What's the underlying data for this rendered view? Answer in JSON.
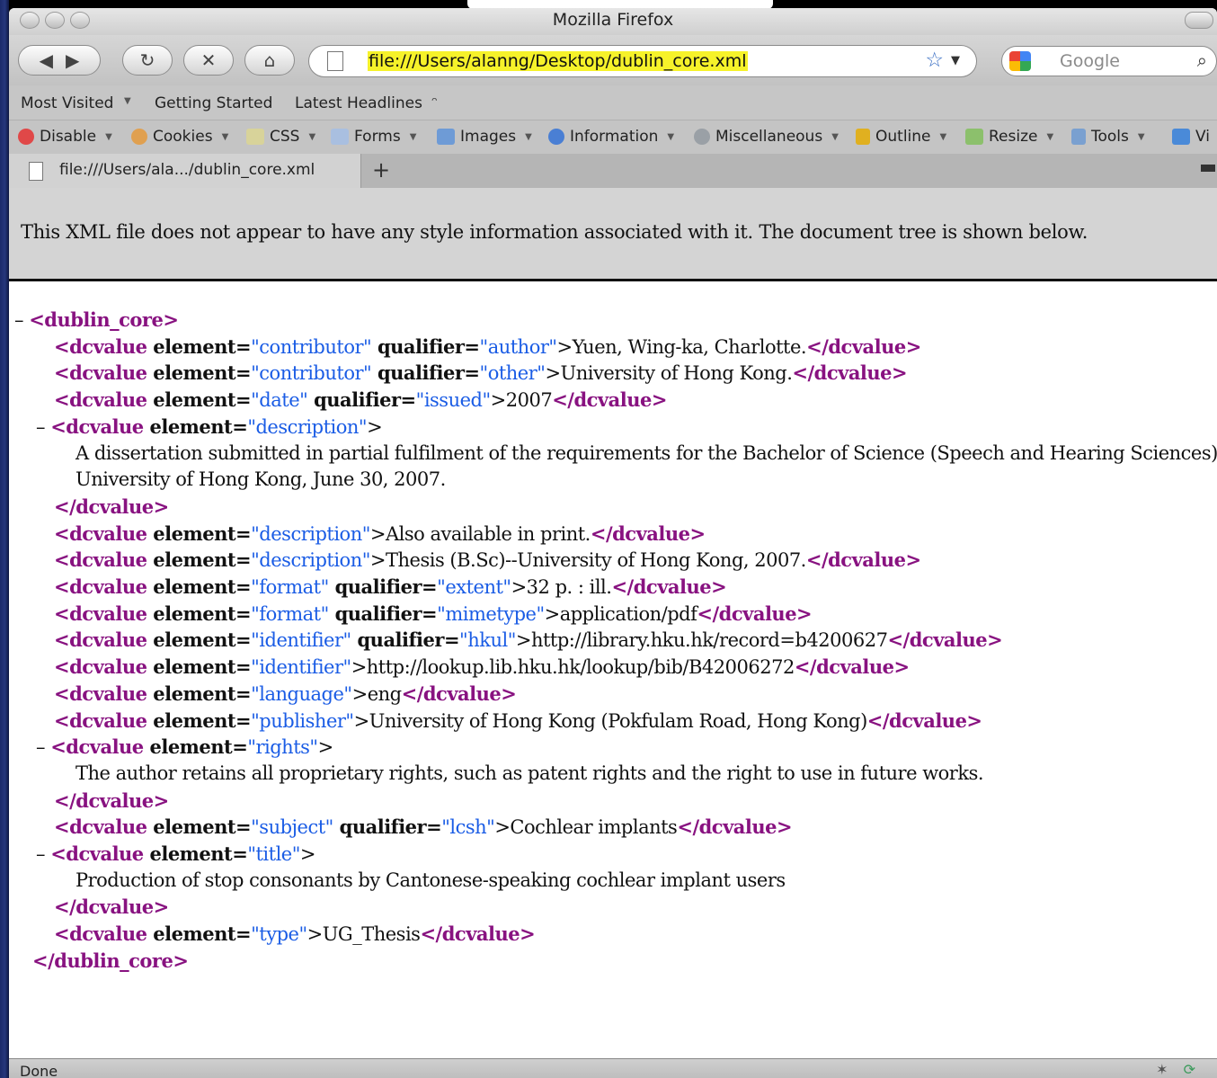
{
  "window": {
    "title": "Mozilla Firefox"
  },
  "nav": {
    "url": "file:///Users/alanng/Desktop/dublin_core.xml",
    "search_placeholder": "Google"
  },
  "bookmarks": [
    "Most Visited",
    "Getting Started",
    "Latest Headlines"
  ],
  "webdev_toolbar": [
    "Disable",
    "Cookies",
    "CSS",
    "Forms",
    "Images",
    "Information",
    "Miscellaneous",
    "Outline",
    "Resize",
    "Tools",
    "Vi"
  ],
  "tab": {
    "label": "file:///Users/ala.../dublin_core.xml",
    "new_tab": "+"
  },
  "notice": "This XML file does not appear to have any style information associated with it. The document tree is shown below.",
  "xml": {
    "root_open": "<dublin_core>",
    "root_close": "</dublin_core>",
    "collapse": "–",
    "tag_open": "<dcvalue",
    "tag_close": "</dcvalue>",
    "attr_element": "element=",
    "attr_qualifier": "qualifier=",
    "lines": [
      {
        "element": "\"contributor\"",
        "qualifier": "\"author\"",
        "text": ">Yuen, Wing-ka, Charlotte."
      },
      {
        "element": "\"contributor\"",
        "qualifier": "\"other\"",
        "text": ">University of Hong Kong."
      },
      {
        "element": "\"date\"",
        "qualifier": "\"issued\"",
        "text": ">2007"
      },
      {
        "element": "\"description\"",
        "text": ">",
        "body": [
          "A dissertation submitted in partial fulfilment of the requirements for the Bachelor of Science (Speech and Hearing Sciences), The",
          "University of Hong Kong, June 30, 2007."
        ]
      },
      {
        "element": "\"description\"",
        "text": ">Also available in print."
      },
      {
        "element": "\"description\"",
        "text": ">Thesis (B.Sc)--University of Hong Kong, 2007."
      },
      {
        "element": "\"format\"",
        "qualifier": "\"extent\"",
        "text": ">32 p. : ill."
      },
      {
        "element": "\"format\"",
        "qualifier": "\"mimetype\"",
        "text": ">application/pdf"
      },
      {
        "element": "\"identifier\"",
        "qualifier": "\"hkul\"",
        "text": ">http://library.hku.hk/record=b4200627"
      },
      {
        "element": "\"identifier\"",
        "text": ">http://lookup.lib.hku.hk/lookup/bib/B42006272"
      },
      {
        "element": "\"language\"",
        "text": ">eng"
      },
      {
        "element": "\"publisher\"",
        "text": ">University of Hong Kong (Pokfulam Road, Hong Kong)"
      },
      {
        "element": "\"rights\"",
        "text": ">",
        "body": [
          "The author retains all proprietary rights, such as patent rights and the right to use in future works."
        ]
      },
      {
        "element": "\"subject\"",
        "qualifier": "\"lcsh\"",
        "text": ">Cochlear implants"
      },
      {
        "element": "\"title\"",
        "text": ">",
        "body": [
          "Production of stop consonants by Cantonese-speaking cochlear implant users"
        ]
      },
      {
        "element": "\"type\"",
        "text": ">UG_Thesis"
      }
    ]
  },
  "status": {
    "text": "Done"
  }
}
